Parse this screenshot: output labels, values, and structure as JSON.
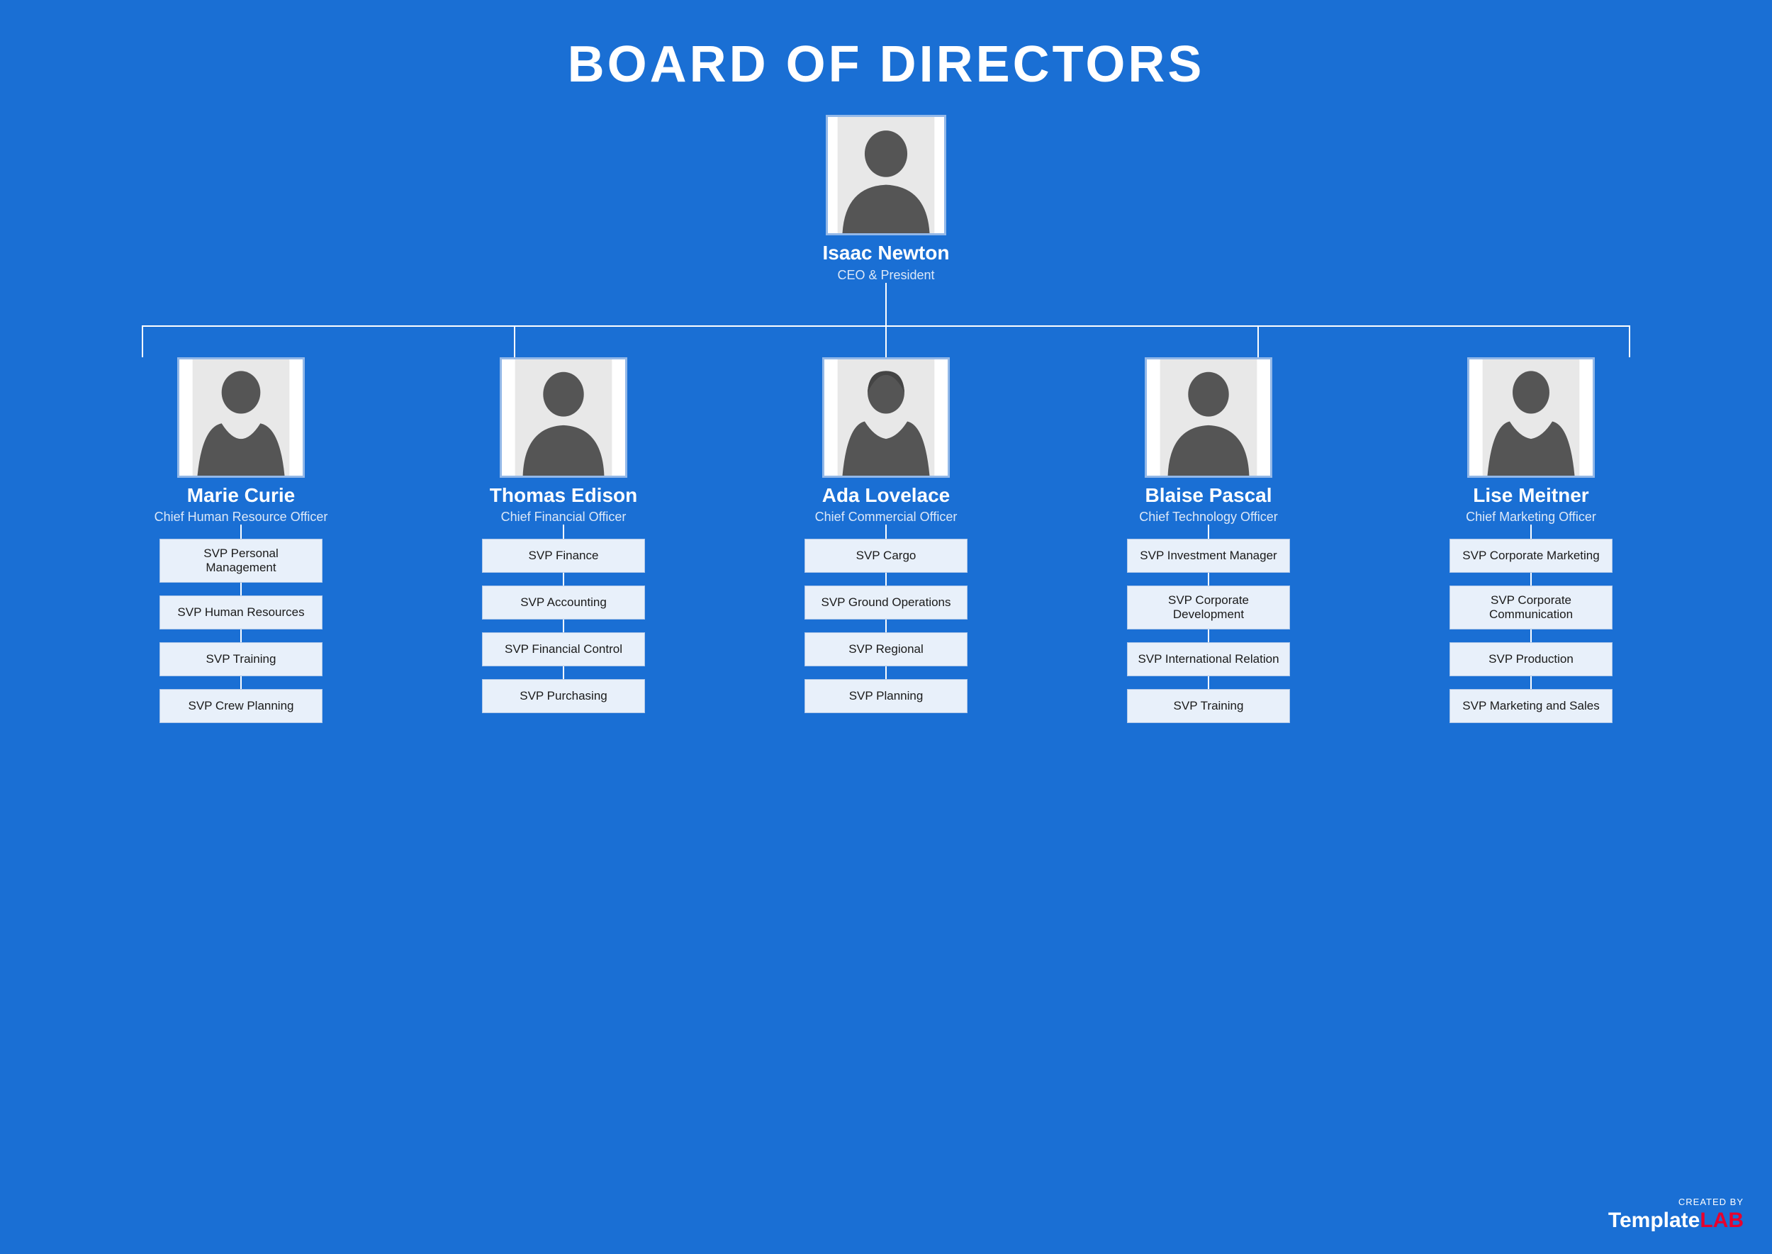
{
  "title": "BOARD OF DIRECTORS",
  "ceo": {
    "name": "Isaac Newton",
    "title": "CEO & President"
  },
  "level2": [
    {
      "name": "Marie Curie",
      "title": "Chief Human Resource Officer",
      "svp": [
        "SVP Personal Management",
        "SVP Human Resources",
        "SVP Training",
        "SVP Crew Planning"
      ]
    },
    {
      "name": "Thomas Edison",
      "title": "Chief Financial Officer",
      "svp": [
        "SVP Finance",
        "SVP Accounting",
        "SVP Financial Control",
        "SVP Purchasing"
      ]
    },
    {
      "name": "Ada Lovelace",
      "title": "Chief Commercial Officer",
      "svp": [
        "SVP Cargo",
        "SVP Ground Operations",
        "SVP Regional",
        "SVP Planning"
      ]
    },
    {
      "name": "Blaise Pascal",
      "title": "Chief Technology Officer",
      "svp": [
        "SVP Investment Manager",
        "SVP Corporate Development",
        "SVP International Relation",
        "SVP Training"
      ]
    },
    {
      "name": "Lise Meitner",
      "title": "Chief Marketing Officer",
      "svp": [
        "SVP Corporate Marketing",
        "SVP Corporate Communication",
        "SVP Production",
        "SVP Marketing and Sales"
      ]
    }
  ],
  "watermark": {
    "created_by": "CREATED BY",
    "logo_white": "Template",
    "logo_red": "LAB"
  }
}
